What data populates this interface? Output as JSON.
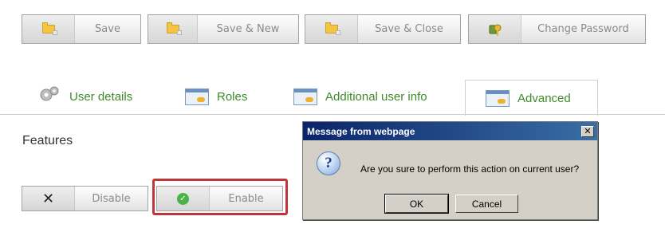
{
  "toolbar": {
    "save_label": "Save",
    "save_new_label": "Save & New",
    "save_close_label": "Save & Close",
    "change_password_label": "Change Password"
  },
  "tabs": [
    {
      "label": "User details",
      "icon": "gear-icon"
    },
    {
      "label": "Roles",
      "icon": "window-key-icon"
    },
    {
      "label": "Additional user info",
      "icon": "window-key-icon"
    },
    {
      "label": "Advanced",
      "icon": "window-key-icon",
      "active": true
    }
  ],
  "features": {
    "title": "Features",
    "disable_label": "Disable",
    "enable_label": "Enable"
  },
  "dialog": {
    "title": "Message from webpage",
    "close_glyph": "✕",
    "icon_glyph": "?",
    "message": "Are you sure to perform this action on current user?",
    "ok_label": "OK",
    "cancel_label": "Cancel"
  },
  "colors": {
    "tab_text": "#3f8a2a",
    "highlight": "#c0343b",
    "dialog_title_start": "#0a246a",
    "dialog_title_end": "#3a6ea5"
  }
}
